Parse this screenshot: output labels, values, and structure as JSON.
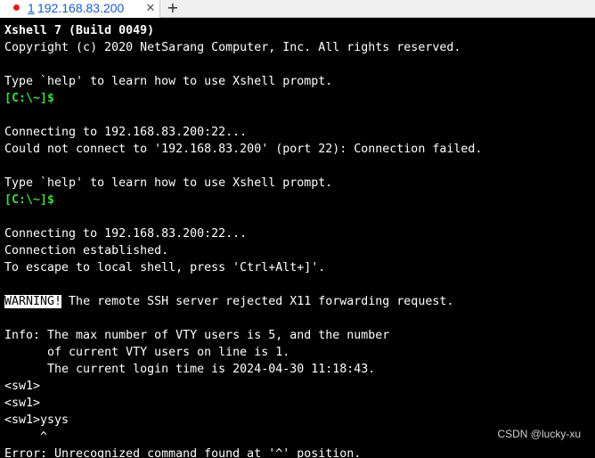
{
  "tab": {
    "number": "1",
    "title": "192.168.83.200",
    "close_label": "✕",
    "new_tab_label": "+"
  },
  "terminal": {
    "l1": "Xshell 7 (Build 0049)",
    "l2": "Copyright (c) 2020 NetSarang Computer, Inc. All rights reserved.",
    "l3": "",
    "l4": "Type `help' to learn how to use Xshell prompt.",
    "l5": "[C:\\~]$",
    "l6": "",
    "l7": "Connecting to 192.168.83.200:22...",
    "l8": "Could not connect to '192.168.83.200' (port 22): Connection failed.",
    "l9": "",
    "l10": "Type `help' to learn how to use Xshell prompt.",
    "l11": "[C:\\~]$",
    "l12": "",
    "l13": "Connecting to 192.168.83.200:22...",
    "l14": "Connection established.",
    "l15": "To escape to local shell, press 'Ctrl+Alt+]'.",
    "l16": "",
    "l17_warn": "WARNING!",
    "l17_rest": " The remote SSH server rejected X11 forwarding request.",
    "l18": "",
    "l19": "Info: The max number of VTY users is 5, and the number",
    "l20": "      of current VTY users on line is 1.",
    "l21": "      The current login time is 2024-04-30 11:18:43.",
    "l22": "<sw1>",
    "l23": "<sw1>",
    "l24": "<sw1>ysys",
    "l25": "     ^",
    "l26": "Error: Unrecognized command found at '^' position."
  },
  "watermark": "CSDN @lucky-xu",
  "colors": {
    "background": "#000000",
    "text": "#ffffff",
    "prompt": "#3fd83f",
    "tab_text": "#1a5cc8",
    "tab_dot": "#e0201c"
  }
}
